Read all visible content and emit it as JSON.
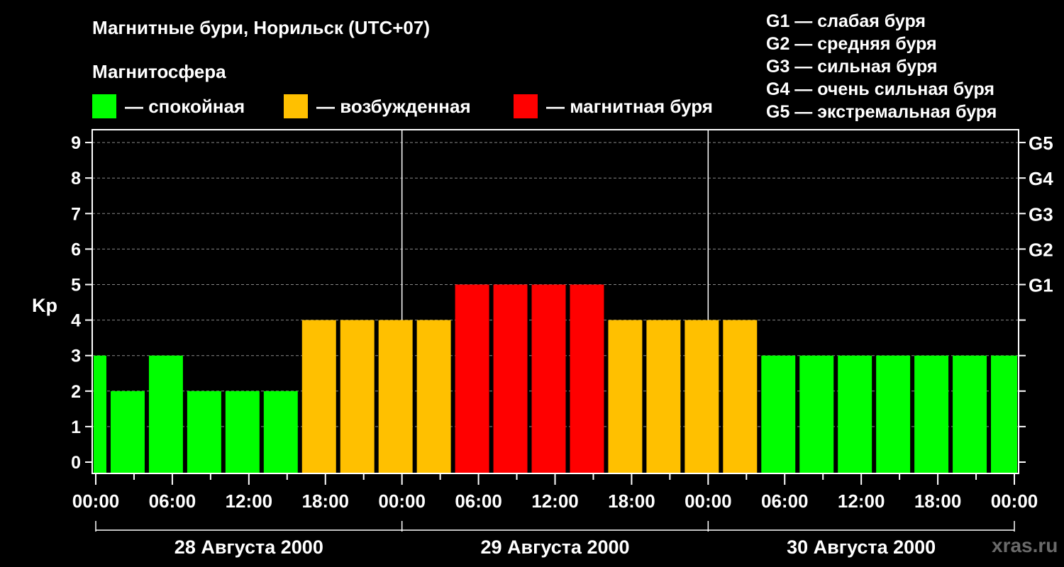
{
  "chart_data": {
    "type": "bar",
    "title": "Магнитные бури, Норильск (UTC+07)",
    "ylabel": "Kp",
    "ylim": [
      -0.3,
      9.4
    ],
    "yticks": [
      "0",
      "1",
      "2",
      "3",
      "4",
      "5",
      "6",
      "7",
      "8",
      "9"
    ],
    "g_scale": [
      {
        "kp": 5,
        "label": "G1"
      },
      {
        "kp": 6,
        "label": "G2"
      },
      {
        "kp": 7,
        "label": "G3"
      },
      {
        "kp": 8,
        "label": "G4"
      },
      {
        "kp": 9,
        "label": "G5"
      }
    ],
    "x_tick_labels": [
      "00:00",
      "06:00",
      "12:00",
      "18:00",
      "00:00",
      "06:00",
      "12:00",
      "18:00",
      "00:00",
      "06:00",
      "12:00",
      "18:00",
      "00:00"
    ],
    "days": [
      "28 Августа 2000",
      "29 Августа 2000",
      "30 Августа 2000"
    ],
    "magnetosphere_label": "Магнитосфера",
    "legend": [
      {
        "label": "— спокойная",
        "color": "#00ff00"
      },
      {
        "label": "— возбужденная",
        "color": "#ffc000"
      },
      {
        "label": "— магнитная буря",
        "color": "#ff0000"
      }
    ],
    "storm_levels": [
      "G1 — слабая буря",
      "G2 — средняя буря",
      "G3 — сильная буря",
      "G4 — очень сильная буря",
      "G5 — экстремальная буря"
    ],
    "bars": [
      {
        "start": "2000-08-27 22:00",
        "end": "2000-08-28 01:00",
        "kp": 3,
        "state": "calm"
      },
      {
        "start": "2000-08-28 01:00",
        "end": "2000-08-28 04:00",
        "kp": 2,
        "state": "calm"
      },
      {
        "start": "2000-08-28 04:00",
        "end": "2000-08-28 07:00",
        "kp": 3,
        "state": "calm"
      },
      {
        "start": "2000-08-28 07:00",
        "end": "2000-08-28 10:00",
        "kp": 2,
        "state": "calm"
      },
      {
        "start": "2000-08-28 10:00",
        "end": "2000-08-28 13:00",
        "kp": 2,
        "state": "calm"
      },
      {
        "start": "2000-08-28 13:00",
        "end": "2000-08-28 16:00",
        "kp": 2,
        "state": "calm"
      },
      {
        "start": "2000-08-28 16:00",
        "end": "2000-08-28 19:00",
        "kp": 4,
        "state": "excited"
      },
      {
        "start": "2000-08-28 19:00",
        "end": "2000-08-28 22:00",
        "kp": 4,
        "state": "excited"
      },
      {
        "start": "2000-08-28 22:00",
        "end": "2000-08-29 01:00",
        "kp": 4,
        "state": "excited"
      },
      {
        "start": "2000-08-29 01:00",
        "end": "2000-08-29 04:00",
        "kp": 4,
        "state": "excited"
      },
      {
        "start": "2000-08-29 04:00",
        "end": "2000-08-29 07:00",
        "kp": 5,
        "state": "storm"
      },
      {
        "start": "2000-08-29 07:00",
        "end": "2000-08-29 10:00",
        "kp": 5,
        "state": "storm"
      },
      {
        "start": "2000-08-29 10:00",
        "end": "2000-08-29 13:00",
        "kp": 5,
        "state": "storm"
      },
      {
        "start": "2000-08-29 13:00",
        "end": "2000-08-29 16:00",
        "kp": 5,
        "state": "storm"
      },
      {
        "start": "2000-08-29 16:00",
        "end": "2000-08-29 19:00",
        "kp": 4,
        "state": "excited"
      },
      {
        "start": "2000-08-29 19:00",
        "end": "2000-08-29 22:00",
        "kp": 4,
        "state": "excited"
      },
      {
        "start": "2000-08-29 22:00",
        "end": "2000-08-30 01:00",
        "kp": 4,
        "state": "excited"
      },
      {
        "start": "2000-08-30 01:00",
        "end": "2000-08-30 04:00",
        "kp": 4,
        "state": "excited"
      },
      {
        "start": "2000-08-30 04:00",
        "end": "2000-08-30 07:00",
        "kp": 3,
        "state": "calm"
      },
      {
        "start": "2000-08-30 07:00",
        "end": "2000-08-30 10:00",
        "kp": 3,
        "state": "calm"
      },
      {
        "start": "2000-08-30 10:00",
        "end": "2000-08-30 13:00",
        "kp": 3,
        "state": "calm"
      },
      {
        "start": "2000-08-30 13:00",
        "end": "2000-08-30 16:00",
        "kp": 3,
        "state": "calm"
      },
      {
        "start": "2000-08-30 16:00",
        "end": "2000-08-30 19:00",
        "kp": 3,
        "state": "calm"
      },
      {
        "start": "2000-08-30 19:00",
        "end": "2000-08-30 22:00",
        "kp": 3,
        "state": "calm"
      },
      {
        "start": "2000-08-30 22:00",
        "end": "2000-08-31 01:00",
        "kp": 3,
        "state": "calm"
      }
    ],
    "x_range": [
      "2000-08-28 00:00",
      "2000-08-31 00:00"
    ],
    "grid": true,
    "state_colors": {
      "calm": "#00ff00",
      "excited": "#ffc000",
      "storm": "#ff0000"
    }
  },
  "watermark": "xras.ru"
}
